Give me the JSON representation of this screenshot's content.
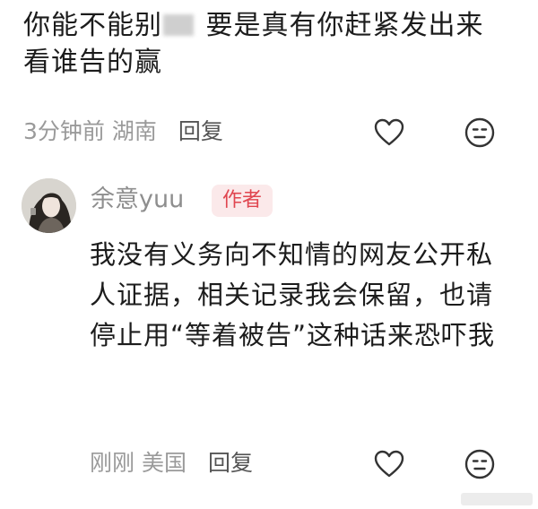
{
  "top_comment": {
    "text_part1": "你能不能别",
    "text_part2": "要是真有你赶紧发出来 看谁告的赢",
    "time": "3分钟前",
    "location": "湖南",
    "reply_label": "回复"
  },
  "reply_comment": {
    "author_name": "余意yuu",
    "author_badge": "作者",
    "text": "我没有义务向不知情的网友公开私人证据，相关记录我会保留，也请停止用“等着被告”这种话来恐吓我",
    "time": "刚刚",
    "location": "美国",
    "reply_label": "回复"
  },
  "colors": {
    "badge_text": "#e0454f",
    "badge_bg": "#fbe9ea",
    "meta_text": "#9a9a9a",
    "icon_stroke": "#333333"
  },
  "icons": [
    "heart-icon",
    "dislike-face-icon",
    "avatar"
  ]
}
